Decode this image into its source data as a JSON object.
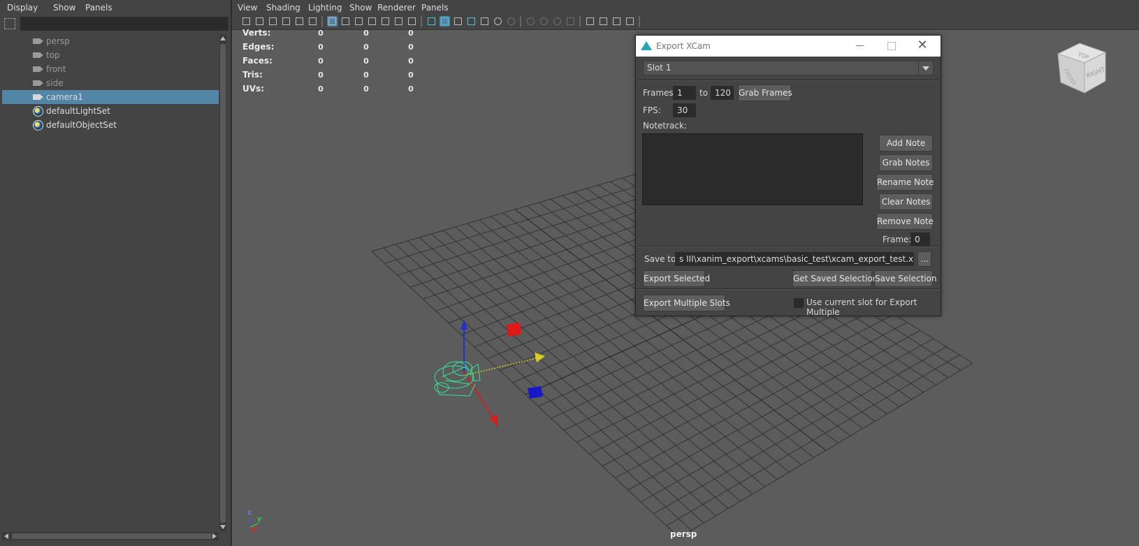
{
  "outliner": {
    "menu": [
      "Display",
      "Show",
      "Panels"
    ],
    "items": [
      {
        "label": "persp",
        "icon": "camera-icon",
        "dim": true
      },
      {
        "label": "top",
        "icon": "camera-icon",
        "dim": true
      },
      {
        "label": "front",
        "icon": "camera-icon",
        "dim": true
      },
      {
        "label": "side",
        "icon": "camera-icon",
        "dim": true
      },
      {
        "label": "camera1",
        "icon": "camera-icon",
        "selected": true
      },
      {
        "label": "defaultLightSet",
        "icon": "set-icon"
      },
      {
        "label": "defaultObjectSet",
        "icon": "set-icon"
      }
    ]
  },
  "viewport": {
    "menu": [
      "View",
      "Shading",
      "Lighting",
      "Show",
      "Renderer",
      "Panels"
    ],
    "hud": [
      {
        "label": "Verts:",
        "values": [
          "0",
          "0",
          "0"
        ]
      },
      {
        "label": "Edges:",
        "values": [
          "0",
          "0",
          "0"
        ]
      },
      {
        "label": "Faces:",
        "values": [
          "0",
          "0",
          "0"
        ]
      },
      {
        "label": "Tris:",
        "values": [
          "0",
          "0",
          "0"
        ]
      },
      {
        "label": "UVs:",
        "values": [
          "0",
          "0",
          "0"
        ]
      }
    ],
    "camera_label": "persp",
    "axis_labels": {
      "z": "z",
      "y": "y",
      "x": "x"
    },
    "viewcube": {
      "top": "TOP",
      "right": "RIGHT",
      "front": "FRONT"
    }
  },
  "dialog": {
    "title": "Export XCam",
    "slot": "Slot 1",
    "frames_label": "Frames:",
    "frame_start": "1",
    "to_label": "to",
    "frame_end": "120",
    "grab_frames": "Grab Frames",
    "fps_label": "FPS:",
    "fps": "30",
    "notetrack_label": "Notetrack:",
    "add_note": "Add Note",
    "grab_notes": "Grab Notes",
    "rename_note": "Rename Note",
    "clear_notes": "Clear Notes",
    "remove_note": "Remove Note",
    "frame_label": "Frame:",
    "frame_value": "0",
    "save_to_label": "Save to:",
    "save_path": "s III\\xanim_export\\xcams\\basic_test\\xcam_export_test.xcam_export",
    "browse": "...",
    "export_selected": "Export Selected",
    "get_saved_selection": "Get Saved Selection",
    "save_selection": "Save Selection",
    "export_multiple": "Export Multiple Slots",
    "use_current_slot": "Use current slot for Export Multiple"
  }
}
